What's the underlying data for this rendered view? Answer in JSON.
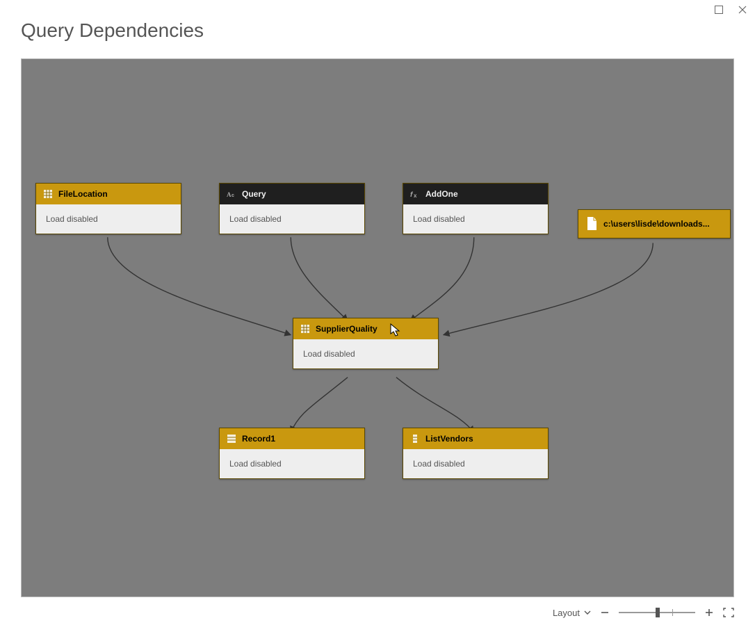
{
  "window": {
    "title": "Query Dependencies"
  },
  "nodes": {
    "fileLocation": {
      "label": "FileLocation",
      "status": "Load disabled",
      "iconName": "table-icon",
      "headerStyle": "gold"
    },
    "query": {
      "label": "Query",
      "status": "Load disabled",
      "iconName": "abc-icon",
      "headerStyle": "dark"
    },
    "addOne": {
      "label": "AddOne",
      "status": "Load disabled",
      "iconName": "fx-icon",
      "headerStyle": "dark"
    },
    "filePath": {
      "label": "c:\\users\\lisde\\downloads...",
      "status": "",
      "iconName": "file-icon",
      "headerStyle": "gold"
    },
    "supplierQuality": {
      "label": "SupplierQuality",
      "status": "Load disabled",
      "iconName": "table-icon",
      "headerStyle": "gold"
    },
    "record1": {
      "label": "Record1",
      "status": "Load disabled",
      "iconName": "record-icon",
      "headerStyle": "gold"
    },
    "listVendors": {
      "label": "ListVendors",
      "status": "Load disabled",
      "iconName": "list-icon",
      "headerStyle": "gold"
    }
  },
  "connections": [
    {
      "from": "fileLocation",
      "to": "supplierQuality"
    },
    {
      "from": "query",
      "to": "supplierQuality"
    },
    {
      "from": "addOne",
      "to": "supplierQuality"
    },
    {
      "from": "filePath",
      "to": "supplierQuality"
    },
    {
      "from": "supplierQuality",
      "to": "record1"
    },
    {
      "from": "supplierQuality",
      "to": "listVendors"
    }
  ],
  "footer": {
    "layoutLabel": "Layout"
  },
  "colors": {
    "goldHeader": "#c9980f",
    "darkHeader": "#1f1f1f",
    "canvasBg": "#7d7d7d"
  }
}
